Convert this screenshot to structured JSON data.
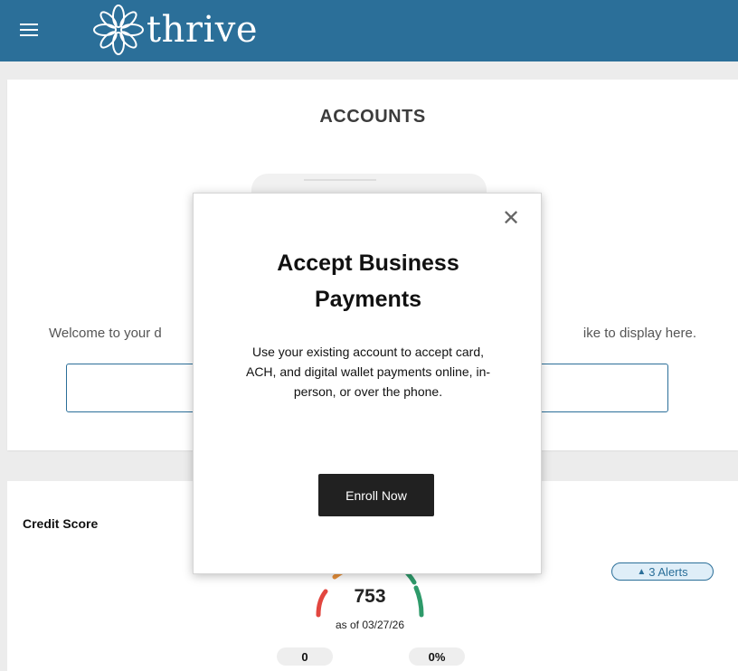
{
  "app": {
    "logo_text": "thrive"
  },
  "accounts": {
    "title": "ACCOUNTS",
    "welcome_left": "Welcome to your d",
    "welcome_right": "ike to display here."
  },
  "credit": {
    "title": "Credit Score",
    "alerts_label": "3 Alerts",
    "score": "753",
    "as_of": "as of 03/27/26",
    "stat_1": "0",
    "stat_2": "0%"
  },
  "modal": {
    "close_glyph": "✕",
    "title": "Accept Business Payments",
    "body": "Use your existing account to accept card, ACH, and digital wallet payments online, in-person, or over the phone.",
    "button_label": "Enroll Now"
  },
  "colors": {
    "brand": "#2b6f99",
    "button_dark": "#212121",
    "gauge_red": "#e2463f",
    "gauge_orange": "#e8903a",
    "gauge_green": "#2e9a6a"
  },
  "icons": [
    "menu-icon",
    "thrive-flower-logo-icon",
    "close-icon",
    "bell-icon"
  ]
}
